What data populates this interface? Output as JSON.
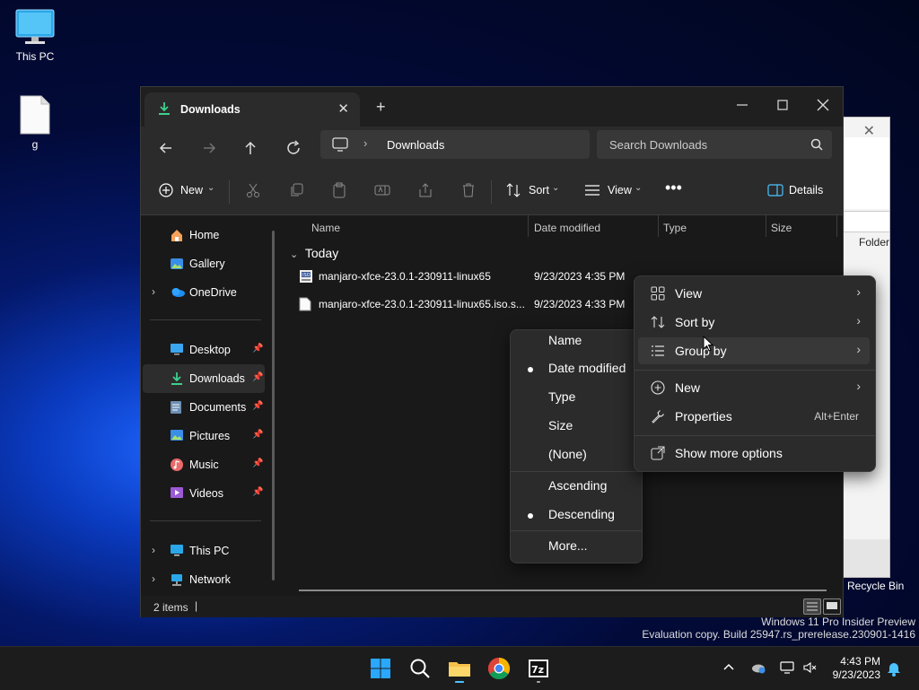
{
  "desktop": {
    "icons": [
      {
        "label": "This PC",
        "icon": "monitor-icon"
      },
      {
        "label": "g",
        "icon": "file-icon"
      }
    ],
    "recycle_bin_label": "Recycle Bin",
    "bg_window_folder_text": "Folder"
  },
  "explorer": {
    "tab_title": "Downloads",
    "address": {
      "current": "Downloads"
    },
    "search_placeholder": "Search Downloads",
    "toolbar": {
      "new_label": "New",
      "sort_label": "Sort",
      "view_label": "View",
      "details_label": "Details"
    },
    "nav": [
      {
        "label": "Home",
        "icon": "home-icon"
      },
      {
        "label": "Gallery",
        "icon": "gallery-icon"
      },
      {
        "label": "OneDrive",
        "icon": "cloud-icon"
      },
      {
        "label": "Desktop",
        "icon": "desktop-icon"
      },
      {
        "label": "Downloads",
        "icon": "download-icon"
      },
      {
        "label": "Documents",
        "icon": "documents-icon"
      },
      {
        "label": "Pictures",
        "icon": "pictures-icon"
      },
      {
        "label": "Music",
        "icon": "music-icon"
      },
      {
        "label": "Videos",
        "icon": "videos-icon"
      },
      {
        "label": "This PC",
        "icon": "monitor-icon"
      },
      {
        "label": "Network",
        "icon": "network-icon"
      }
    ],
    "columns": [
      "Name",
      "Date modified",
      "Type",
      "Size"
    ],
    "group_header": "Today",
    "files": [
      {
        "name": "manjaro-xfce-23.0.1-230911-linux65",
        "date": "9/23/2023 4:35 PM",
        "icon": "iso-file-icon"
      },
      {
        "name": "manjaro-xfce-23.0.1-230911-linux65.iso.s...",
        "date": "9/23/2023 4:33 PM",
        "icon": "file-icon"
      }
    ],
    "status": {
      "items": "2 items",
      "cursor": "|"
    }
  },
  "context_menu": {
    "items": [
      {
        "label": "View",
        "icon": "grid-icon"
      },
      {
        "label": "Sort by",
        "icon": "sort-icon"
      },
      {
        "label": "Group by",
        "icon": "list-icon"
      },
      {
        "label": "New",
        "icon": "plus-circle-icon"
      },
      {
        "label": "Properties",
        "icon": "wrench-icon",
        "shortcut": "Alt+Enter"
      },
      {
        "label": "Show more options",
        "icon": "open-external-icon"
      }
    ]
  },
  "submenu": {
    "items": [
      "Name",
      "Date modified",
      "Type",
      "Size",
      "(None)",
      "Ascending",
      "Descending",
      "More..."
    ],
    "selected": [
      "Date modified",
      "Descending"
    ]
  },
  "watermark": {
    "line1": "Windows 11 Pro Insider Preview",
    "line2": "Evaluation copy. Build 25947.rs_prerelease.230901-1416"
  },
  "taskbar": {
    "time": "4:43 PM",
    "date": "9/23/2023"
  },
  "colors": {
    "accent": "#4cc2ff",
    "menu_bg": "#2b2b2b",
    "explorer_bg": "#191919"
  }
}
